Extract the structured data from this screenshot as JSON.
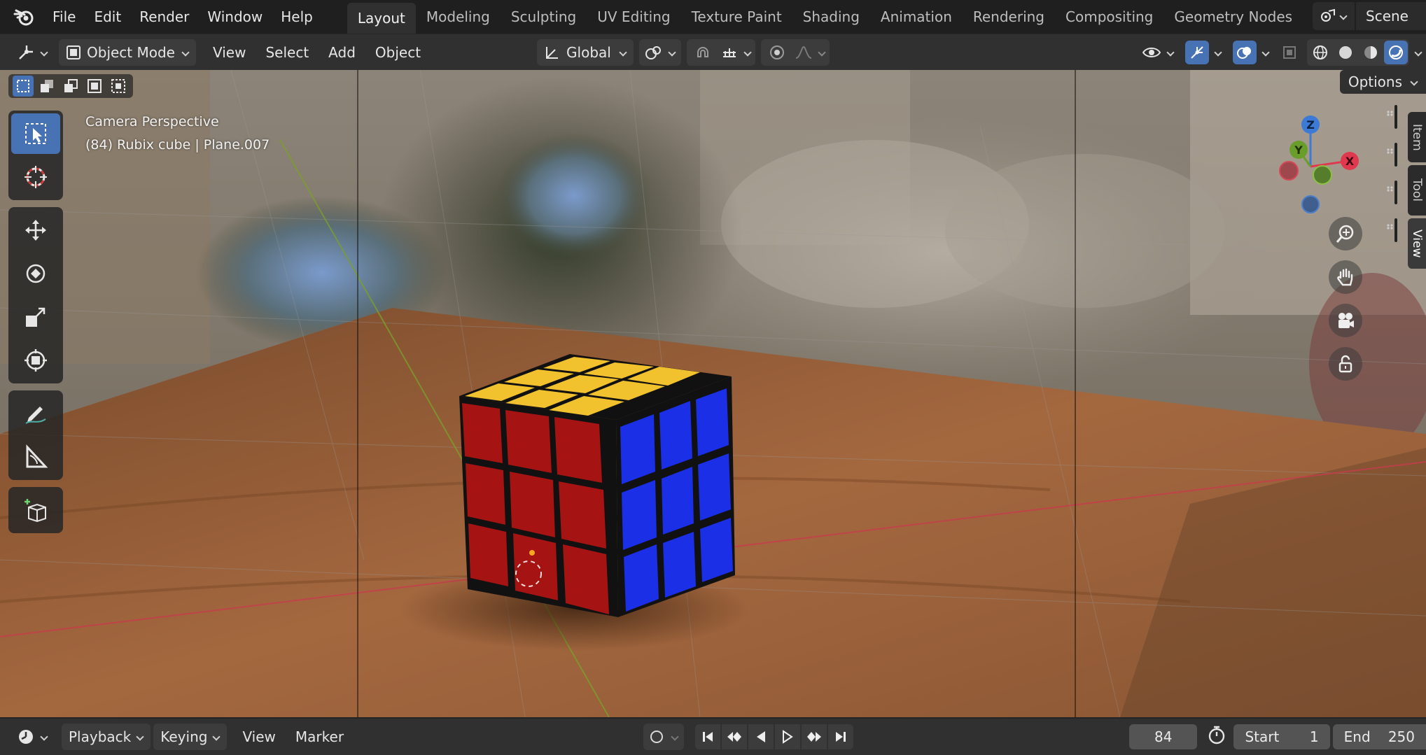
{
  "top_menu": {
    "items": [
      "File",
      "Edit",
      "Render",
      "Window",
      "Help"
    ]
  },
  "workspace_tabs": [
    {
      "label": "Layout",
      "active": true
    },
    {
      "label": "Modeling",
      "active": false
    },
    {
      "label": "Sculpting",
      "active": false
    },
    {
      "label": "UV Editing",
      "active": false
    },
    {
      "label": "Texture Paint",
      "active": false
    },
    {
      "label": "Shading",
      "active": false
    },
    {
      "label": "Animation",
      "active": false
    },
    {
      "label": "Rendering",
      "active": false
    },
    {
      "label": "Compositing",
      "active": false
    },
    {
      "label": "Geometry Nodes",
      "active": false
    }
  ],
  "scene": {
    "name": "Scene"
  },
  "header": {
    "mode": "Object Mode",
    "menus": [
      "View",
      "Select",
      "Add",
      "Object"
    ],
    "orientation": "Global"
  },
  "viewport": {
    "overlay_title": "Camera Perspective",
    "overlay_object": "(84) Rubix cube | Plane.007",
    "options_label": "Options",
    "side_tabs": [
      "Item",
      "Tool",
      "View"
    ],
    "gizmo_axes": {
      "x": "X",
      "y": "Y",
      "z": "Z"
    }
  },
  "timeline": {
    "menus": [
      "Playback",
      "Keying",
      "View",
      "Marker"
    ],
    "current_frame": "84",
    "start_label": "Start",
    "start_value": "1",
    "end_label": "End",
    "end_value": "250"
  },
  "colors": {
    "accent": "#4772b3",
    "axis_x": "#e0394f",
    "axis_y": "#6a9e2a",
    "axis_z": "#3c7ad6"
  }
}
